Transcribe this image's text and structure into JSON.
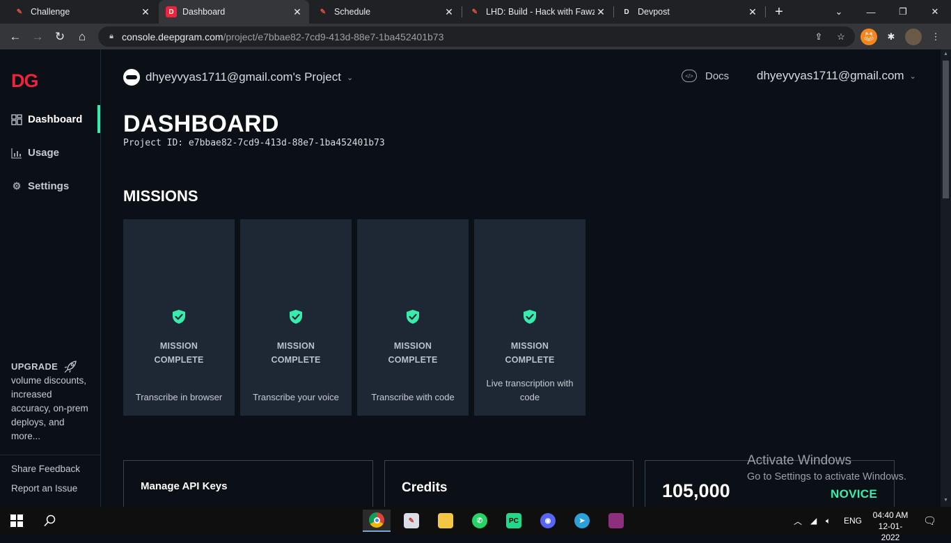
{
  "browser": {
    "tabs": [
      {
        "title": "Challenge",
        "icon": "hackathon-favicon",
        "active": false
      },
      {
        "title": "Dashboard",
        "icon": "deepgram-favicon",
        "active": true
      },
      {
        "title": "Schedule",
        "icon": "hackathon-favicon",
        "active": false
      },
      {
        "title": "LHD: Build - Hack with Fawzi",
        "icon": "hackathon-favicon",
        "active": false
      },
      {
        "title": "Devpost",
        "icon": "devpost-favicon",
        "active": false
      }
    ],
    "url_host": "console.deepgram.com",
    "url_path": "/project/e7bbae82-7cd9-413d-88e7-1ba452401b73"
  },
  "sidebar": {
    "logo": "DG",
    "items": [
      {
        "label": "Dashboard",
        "icon": "grid-icon",
        "active": true
      },
      {
        "label": "Usage",
        "icon": "bar-chart-icon",
        "active": false
      },
      {
        "label": "Settings",
        "icon": "gear-icon",
        "active": false
      }
    ],
    "upgrade_title": "UPGRADE",
    "upgrade_text": "volume discounts, increased accuracy, on-prem deploys, and more...",
    "share_feedback": "Share Feedback",
    "report_issue": "Report an Issue"
  },
  "header": {
    "project_name": "dhyeyvyas1711@gmail.com's Project",
    "docs_label": "Docs",
    "user_email": "dhyeyvyas1711@gmail.com"
  },
  "dashboard": {
    "title": "DASHBOARD",
    "project_id": "Project ID: e7bbae82-7cd9-413d-88e7-1ba452401b73",
    "missions_title": "MISSIONS",
    "missions": [
      {
        "status_line1": "MISSION",
        "status_line2": "COMPLETE",
        "label": "Transcribe in browser"
      },
      {
        "status_line1": "MISSION",
        "status_line2": "COMPLETE",
        "label": "Transcribe your voice"
      },
      {
        "status_line1": "MISSION",
        "status_line2": "COMPLETE",
        "label": "Transcribe with code"
      },
      {
        "status_line1": "MISSION",
        "status_line2": "COMPLETE",
        "label": "Live transcription with code"
      }
    ],
    "cards": [
      {
        "title": "Manage API Keys"
      },
      {
        "title": "Credits"
      },
      {
        "title": "105,000",
        "badge": "NOVICE"
      }
    ]
  },
  "watermark": {
    "line1": "Activate Windows",
    "line2": "Go to Settings to activate Windows."
  },
  "taskbar": {
    "language": "ENG",
    "time": "04:40 AM",
    "date": "12-01-2022"
  },
  "colors": {
    "accent": "#38edac",
    "brand_red": "#ef233c",
    "background": "#0b1016",
    "card": "#1e2835"
  }
}
